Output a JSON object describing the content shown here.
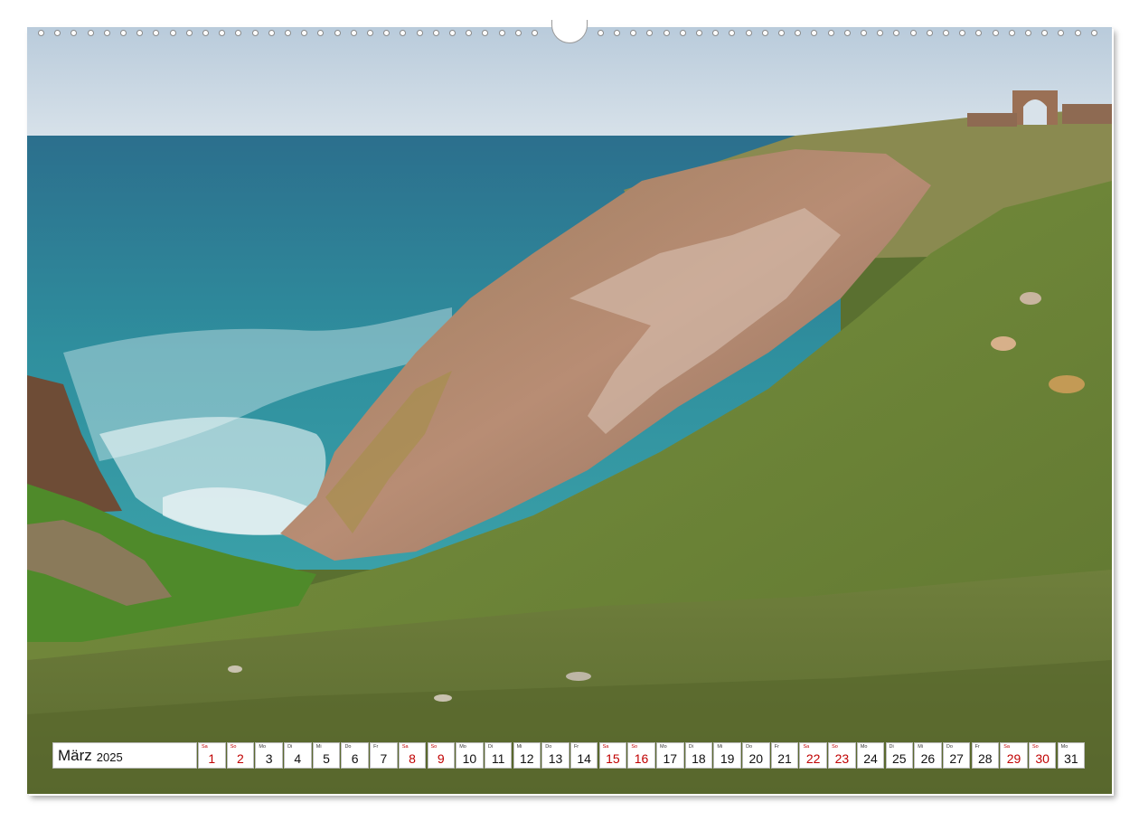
{
  "calendar": {
    "month": "März",
    "year": "2025",
    "weekend_color": "#c00000",
    "days": [
      {
        "dow": "Sa",
        "n": "1",
        "weekend": true
      },
      {
        "dow": "So",
        "n": "2",
        "weekend": true
      },
      {
        "dow": "Mo",
        "n": "3",
        "weekend": false
      },
      {
        "dow": "Di",
        "n": "4",
        "weekend": false
      },
      {
        "dow": "Mi",
        "n": "5",
        "weekend": false
      },
      {
        "dow": "Do",
        "n": "6",
        "weekend": false
      },
      {
        "dow": "Fr",
        "n": "7",
        "weekend": false
      },
      {
        "dow": "Sa",
        "n": "8",
        "weekend": true
      },
      {
        "dow": "So",
        "n": "9",
        "weekend": true
      },
      {
        "dow": "Mo",
        "n": "10",
        "weekend": false
      },
      {
        "dow": "Di",
        "n": "11",
        "weekend": false
      },
      {
        "dow": "Mi",
        "n": "12",
        "weekend": false
      },
      {
        "dow": "Do",
        "n": "13",
        "weekend": false
      },
      {
        "dow": "Fr",
        "n": "14",
        "weekend": false
      },
      {
        "dow": "Sa",
        "n": "15",
        "weekend": true
      },
      {
        "dow": "So",
        "n": "16",
        "weekend": true
      },
      {
        "dow": "Mo",
        "n": "17",
        "weekend": false
      },
      {
        "dow": "Di",
        "n": "18",
        "weekend": false
      },
      {
        "dow": "Mi",
        "n": "19",
        "weekend": false
      },
      {
        "dow": "Do",
        "n": "20",
        "weekend": false
      },
      {
        "dow": "Fr",
        "n": "21",
        "weekend": false
      },
      {
        "dow": "Sa",
        "n": "22",
        "weekend": true
      },
      {
        "dow": "So",
        "n": "23",
        "weekend": true
      },
      {
        "dow": "Mo",
        "n": "24",
        "weekend": false
      },
      {
        "dow": "Di",
        "n": "25",
        "weekend": false
      },
      {
        "dow": "Mi",
        "n": "26",
        "weekend": false
      },
      {
        "dow": "Do",
        "n": "27",
        "weekend": false
      },
      {
        "dow": "Fr",
        "n": "28",
        "weekend": false
      },
      {
        "dow": "Sa",
        "n": "29",
        "weekend": true
      },
      {
        "dow": "So",
        "n": "30",
        "weekend": true
      },
      {
        "dow": "Mo",
        "n": "31",
        "weekend": false
      }
    ]
  },
  "photo": {
    "subject": "coastal-cliff-photo",
    "colors": {
      "sky": "#c7d6e2",
      "sea": "#2f8c9c",
      "grass": "#6e8a3a",
      "rock": "#b98a6c"
    }
  }
}
